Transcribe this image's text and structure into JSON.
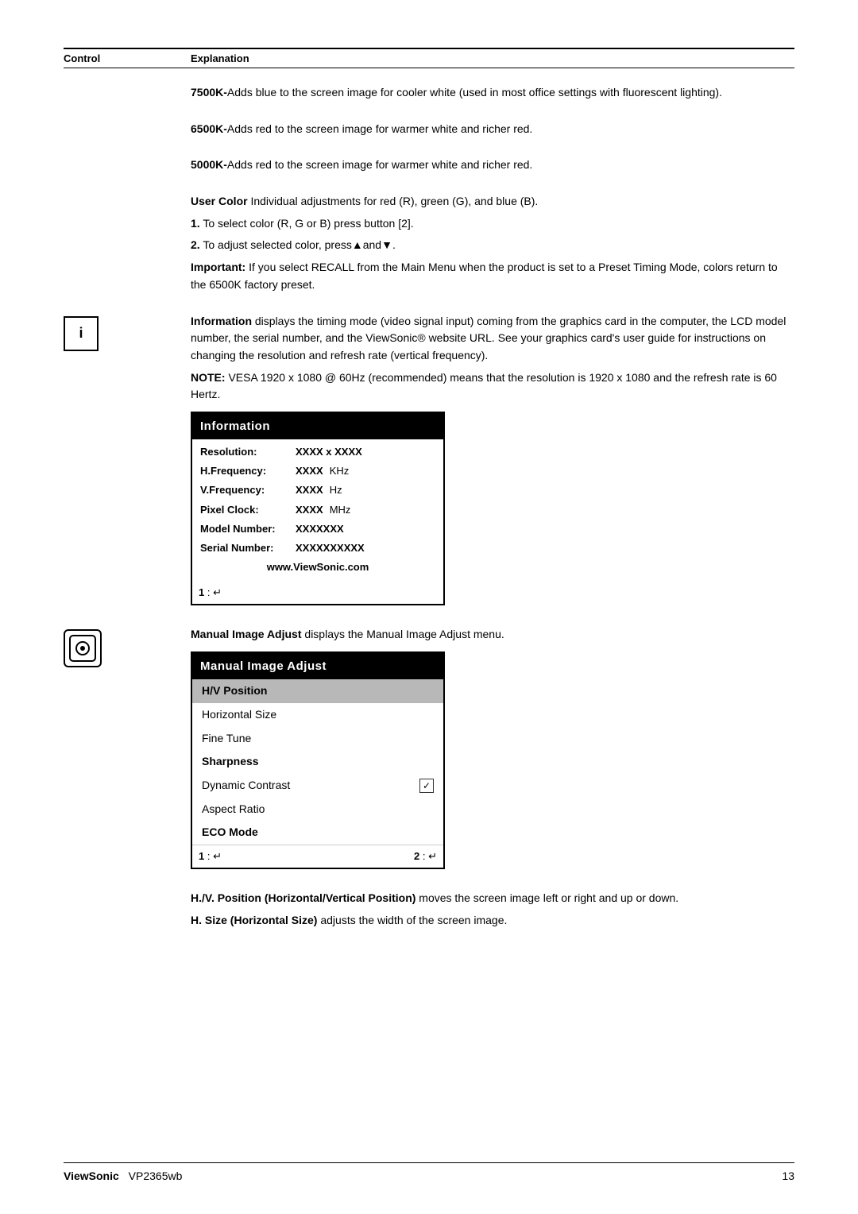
{
  "header": {
    "control_label": "Control",
    "explanation_label": "Explanation"
  },
  "sections": [
    {
      "id": "7500k",
      "has_icon": false,
      "icon_type": null,
      "icon_content": null,
      "paragraphs": [
        "<b>7500K-</b>Adds blue to the screen image for cooler white (used in most office settings with fluorescent lighting)."
      ]
    },
    {
      "id": "6500k",
      "has_icon": false,
      "icon_type": null,
      "icon_content": null,
      "paragraphs": [
        "<b>6500K-</b>Adds red to the screen image for warmer white and richer red."
      ]
    },
    {
      "id": "5000k",
      "has_icon": false,
      "icon_type": null,
      "icon_content": null,
      "paragraphs": [
        "<b>5000K-</b>Adds red to the screen image for warmer white and richer red."
      ]
    },
    {
      "id": "user_color",
      "has_icon": false,
      "icon_type": null,
      "icon_content": null,
      "paragraphs": [
        "<b>User Color</b>  Individual adjustments for red (R), green (G),  and blue (B).",
        "<b>1.</b> To select color (R, G or B) press button [2].",
        "<b>2.</b> To adjust selected color, press▲and▼.",
        "<b>Important:</b> If you select RECALL from the Main Menu when the product is set to a Preset Timing Mode, colors return to the 6500K factory preset."
      ]
    }
  ],
  "information_section": {
    "icon_type": "square_i",
    "icon_content": "i",
    "intro_text": "<b>Information</b> displays the timing mode (video signal input) coming from the graphics card in the computer, the LCD model number, the serial number, and the ViewSonic® website URL. See your graphics card's user guide for instructions on changing the resolution and refresh rate (vertical frequency).",
    "note_text": "<b>NOTE:</b> VESA 1920 x 1080 @ 60Hz (recommended) means that the resolution is 1920 x 1080 and the refresh rate is 60 Hertz.",
    "box": {
      "title": "Information",
      "rows": [
        {
          "label": "Resolution:",
          "value": "XXXX x XXXX",
          "unit": ""
        },
        {
          "label": "H.Frequency:",
          "value": "XXXX",
          "unit": "KHz"
        },
        {
          "label": "V.Frequency:",
          "value": "XXXX",
          "unit": "Hz"
        },
        {
          "label": "Pixel Clock:",
          "value": "XXXX",
          "unit": "MHz"
        },
        {
          "label": "Model Number:",
          "value": "XXXXXXX",
          "unit": ""
        },
        {
          "label": "Serial Number:",
          "value": "XXXXXXXXXX",
          "unit": ""
        }
      ],
      "url": "www.ViewSonic.com",
      "footer": "1 : ↵"
    }
  },
  "manual_image_adjust_section": {
    "icon_type": "round_adjust",
    "icon_content": "⊙",
    "intro_text": "<b>Manual Image Adjust</b> displays the Manual Image Adjust menu.",
    "box": {
      "title": "Manual Image Adjust",
      "items": [
        {
          "label": "H/V Position",
          "selected": true,
          "has_checkbox": false,
          "checked": false
        },
        {
          "label": "Horizontal Size",
          "selected": false,
          "has_checkbox": false,
          "checked": false
        },
        {
          "label": "Fine Tune",
          "selected": false,
          "has_checkbox": false,
          "checked": false
        },
        {
          "label": "Sharpness",
          "selected": false,
          "has_checkbox": false,
          "checked": false
        },
        {
          "label": "Dynamic Contrast",
          "selected": false,
          "has_checkbox": true,
          "checked": true
        },
        {
          "label": "Aspect Ratio",
          "selected": false,
          "has_checkbox": false,
          "checked": false
        },
        {
          "label": "ECO Mode",
          "selected": false,
          "has_checkbox": false,
          "checked": false
        }
      ],
      "footer_left": "1 : ↵",
      "footer_right": "2 : ↵"
    }
  },
  "bottom_paragraphs": [
    "<b>H./V. Position (Horizontal/Vertical Position)</b> moves the screen image left or right and up or down.",
    "<b>H. Size (Horizontal Size)</b> adjusts the width of the screen image."
  ],
  "footer": {
    "brand": "ViewSonic",
    "model": "VP2365wb",
    "page_number": "13"
  }
}
